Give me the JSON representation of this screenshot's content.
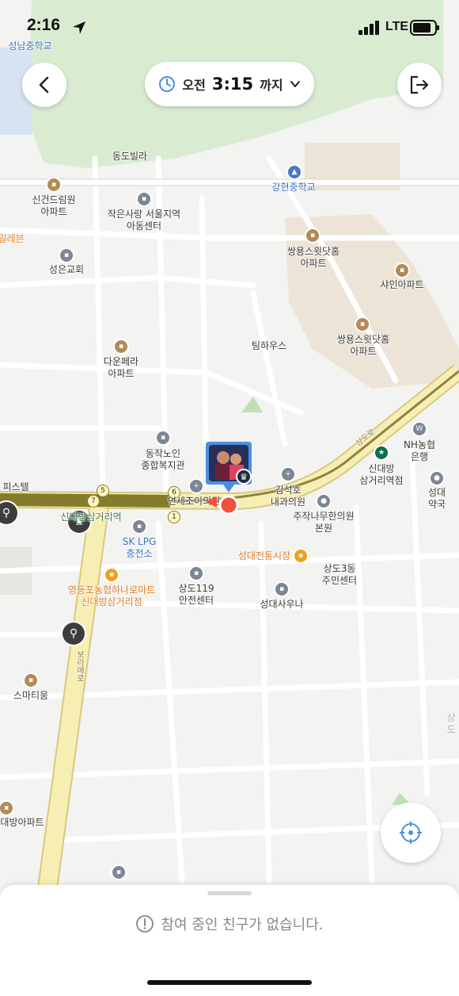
{
  "status_bar": {
    "time": "2:16",
    "network": "LTE"
  },
  "header": {
    "time_pill": {
      "prefix": "오전",
      "time": "3:15",
      "suffix": "까지"
    }
  },
  "map": {
    "labels": {
      "seongnam_middle": "성남중학교",
      "dongdo_villa": "동도빌라",
      "sinkeon_dream": "신건드림원\n아파트",
      "small_love_center": "작은사랑 서울지역\n아동센터",
      "gangnyeon_middle": "강현중학교",
      "ssangyong_1": "쌍용스윗닷홈\n아파트",
      "shine_apt": "샤인아파트",
      "ssangyong_2": "쌍용스윗닷홈\n아파트",
      "seongeun_church": "성은교회",
      "dawoon_perra": "다운페라\n아파트",
      "tim_house": "팀하우스",
      "dongjak_senior": "동작노인\n종합복지관",
      "kim_clinic": "김석호\n내과의원",
      "nh_bank": "NH농협은행",
      "sindaebang_station_exit": "신대방\n삼거리역점",
      "seongdae_pharmacy": "성대약국",
      "jujak_oriental": "주작나무한의원\n본원",
      "sk_lpg": "SK LPG\n충전소",
      "seongdae_market": "성대전통시장",
      "sangdo3_center": "상도3동\n주민센터",
      "yeongdeungpo_mart": "영등포농협하나로마트\n신대방삼거리점",
      "sangdo_119": "상도119\n안전센터",
      "seongdae_sauna": "성대사우나",
      "smartium": "스마티움",
      "daebang_apt": "대방아파트",
      "boramae_ro": "보라매로",
      "sangdo_ro": "상도로",
      "seven_eleven_partial": "일레븐",
      "officetel_partial": "피스텔",
      "station_partial": "신대방삼거리역",
      "severance_partial": "연세조이의원",
      "sangdo_partial": "상도"
    }
  },
  "bottom_sheet": {
    "empty_message": "참여 중인 친구가 없습니다."
  },
  "colors": {
    "accent": "#4a90e2",
    "road_major": "#f5e9a6",
    "subway": "#857b2c",
    "park": "#d9ecd2"
  }
}
